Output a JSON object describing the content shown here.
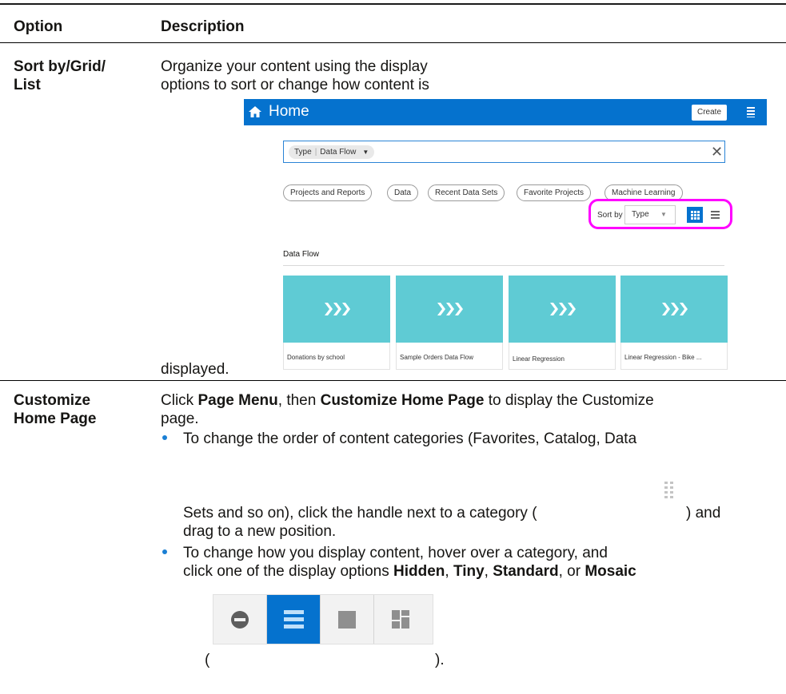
{
  "table": {
    "headers": {
      "option": "Option",
      "description": "Description"
    },
    "row1": {
      "option_line1": "Sort by/Grid/",
      "option_line2": "List",
      "desc_line1": "Organize your content using the display",
      "desc_line2": "options to sort or change how content is",
      "desc_after_image": "displayed."
    },
    "row2": {
      "option_line1": "Customize",
      "option_line2": "Home Page",
      "intro": {
        "click": "Click ",
        "page_menu": "Page Menu",
        "then": ", then ",
        "customize_home_page": "Customize Home Page",
        "to_display": " to display the Customize",
        "page": "page."
      },
      "bullet1": {
        "line1": "To change the order of content categories (Favorites, Catalog, Data",
        "line2a": "Sets and so on), click the handle next to a category (",
        "line2b": ") and",
        "line3": "drag to a new position."
      },
      "bullet2": {
        "line1": "To change how you display content, hover over a category, and",
        "line2_prefix": "click one of the display options ",
        "hidden": "Hidden",
        "sep1": ", ",
        "tiny": "Tiny",
        "sep2": ", ",
        "standard": "Standard",
        "or": ", or ",
        "mosaic": "Mosaic",
        "open_paren": "(",
        "close_paren": ")."
      }
    }
  },
  "screenshot": {
    "header_title": "Home",
    "create_label": "Create",
    "filter_chip": {
      "key": "Type",
      "value": "Data Flow"
    },
    "filters": [
      "Projects and Reports",
      "Data",
      "Recent Data Sets",
      "Favorite Projects",
      "Machine Learning"
    ],
    "sort_label": "Sort by",
    "sort_value": "Type",
    "section_title": "Data Flow",
    "cards": [
      "Donations by school",
      "Sample Orders Data Flow",
      "Linear Regression",
      "Linear Regression - Bike ..."
    ]
  },
  "colors": {
    "brand": "#0572ce",
    "card": "#5fcbd4",
    "highlight": "#ff00ff",
    "bullet": "#1a7fd4"
  },
  "icons": [
    "home-icon",
    "menu-icon",
    "close-icon",
    "grid-view-icon",
    "list-view-icon",
    "data-flow-icon",
    "drag-handle-icon",
    "hidden-icon",
    "tiny-icon",
    "standard-icon",
    "mosaic-icon"
  ]
}
